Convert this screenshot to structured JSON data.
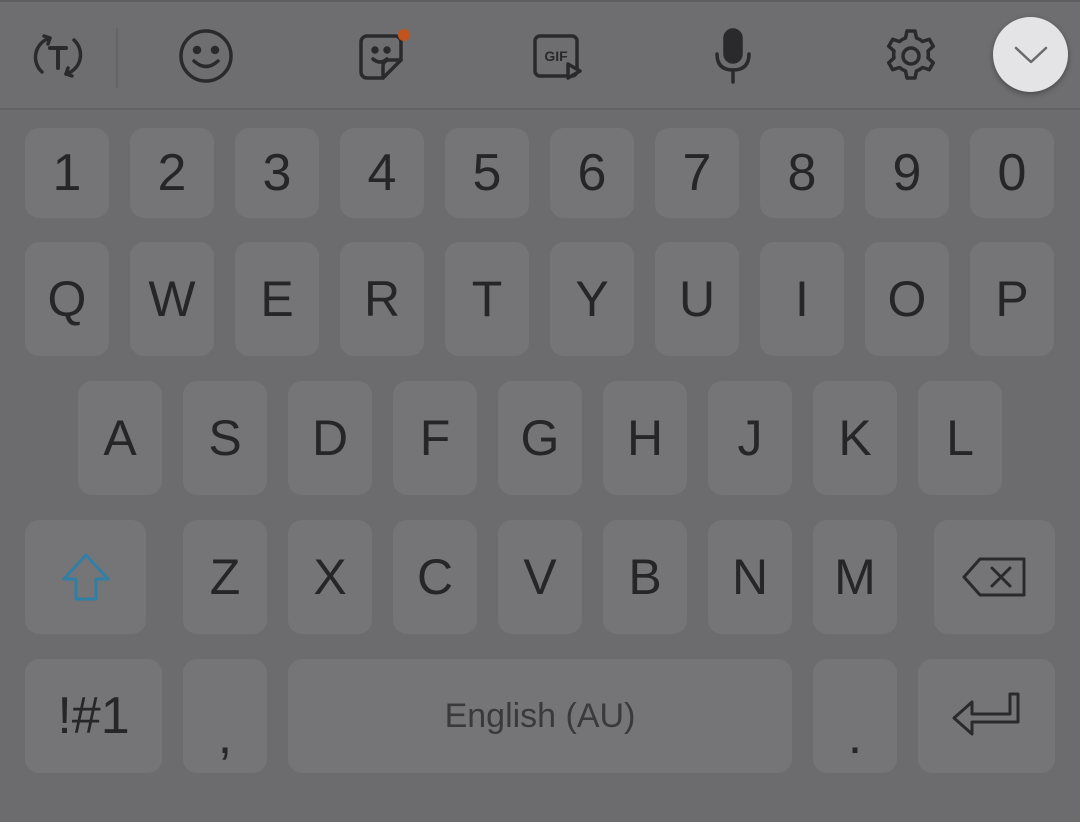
{
  "toolbar": {
    "icons": [
      "text-mode-icon",
      "emoji-icon",
      "sticker-icon",
      "gif-icon",
      "microphone-icon",
      "settings-icon",
      "hide-keyboard-icon"
    ],
    "gif_label": "GIF",
    "sticker_badge_color": "#c0541c"
  },
  "keyboard": {
    "number_row": [
      "1",
      "2",
      "3",
      "4",
      "5",
      "6",
      "7",
      "8",
      "9",
      "0"
    ],
    "row1": [
      "Q",
      "W",
      "E",
      "R",
      "T",
      "Y",
      "U",
      "I",
      "O",
      "P"
    ],
    "row2": [
      "A",
      "S",
      "D",
      "F",
      "G",
      "H",
      "J",
      "K",
      "L"
    ],
    "row3": [
      "Z",
      "X",
      "C",
      "V",
      "B",
      "N",
      "M"
    ],
    "symbols_label": "!#1",
    "comma_label": ",",
    "space_label": "English (AU)",
    "period_label": ".",
    "shift_color": "#2f7fa6"
  }
}
